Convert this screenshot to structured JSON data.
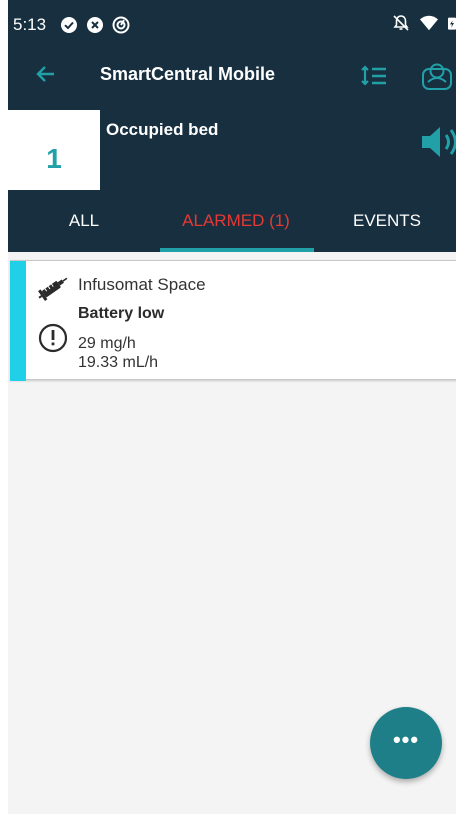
{
  "status_bar": {
    "time": "5:13",
    "left_icons": [
      "check-circle-icon",
      "blocked-icon",
      "sync-icon"
    ],
    "right_icons": [
      "notifications-off-icon",
      "wifi-icon",
      "battery-icon"
    ]
  },
  "app_bar": {
    "title": "SmartCentral Mobile",
    "icons": [
      "back-arrow-icon",
      "sort-icon",
      "bed-view-icon"
    ]
  },
  "bed": {
    "number": "1",
    "status": "Occupied bed",
    "volume_icon": "volume-icon"
  },
  "tabs": [
    {
      "label": "ALL",
      "selected": false
    },
    {
      "label": "ALARMED (1)",
      "selected": true
    },
    {
      "label": "EVENTS",
      "selected": false
    }
  ],
  "alarms": [
    {
      "device": "Infusomat Space",
      "message": "Battery low",
      "rate_1": "29 mg/h",
      "rate_2": "19.33 mL/h",
      "device_icon": "syringe-icon",
      "alert_icon": "alert-icon"
    }
  ],
  "fab": {
    "icon": "more-icon",
    "label": "•••"
  },
  "colors": {
    "header_bg": "#172f3f",
    "accent_teal": "#21a0a8",
    "alarm_red": "#e53935",
    "stripe_cyan": "#20d0e8",
    "fab_bg": "#1e7f88",
    "list_bg": "#f4f4f4"
  }
}
